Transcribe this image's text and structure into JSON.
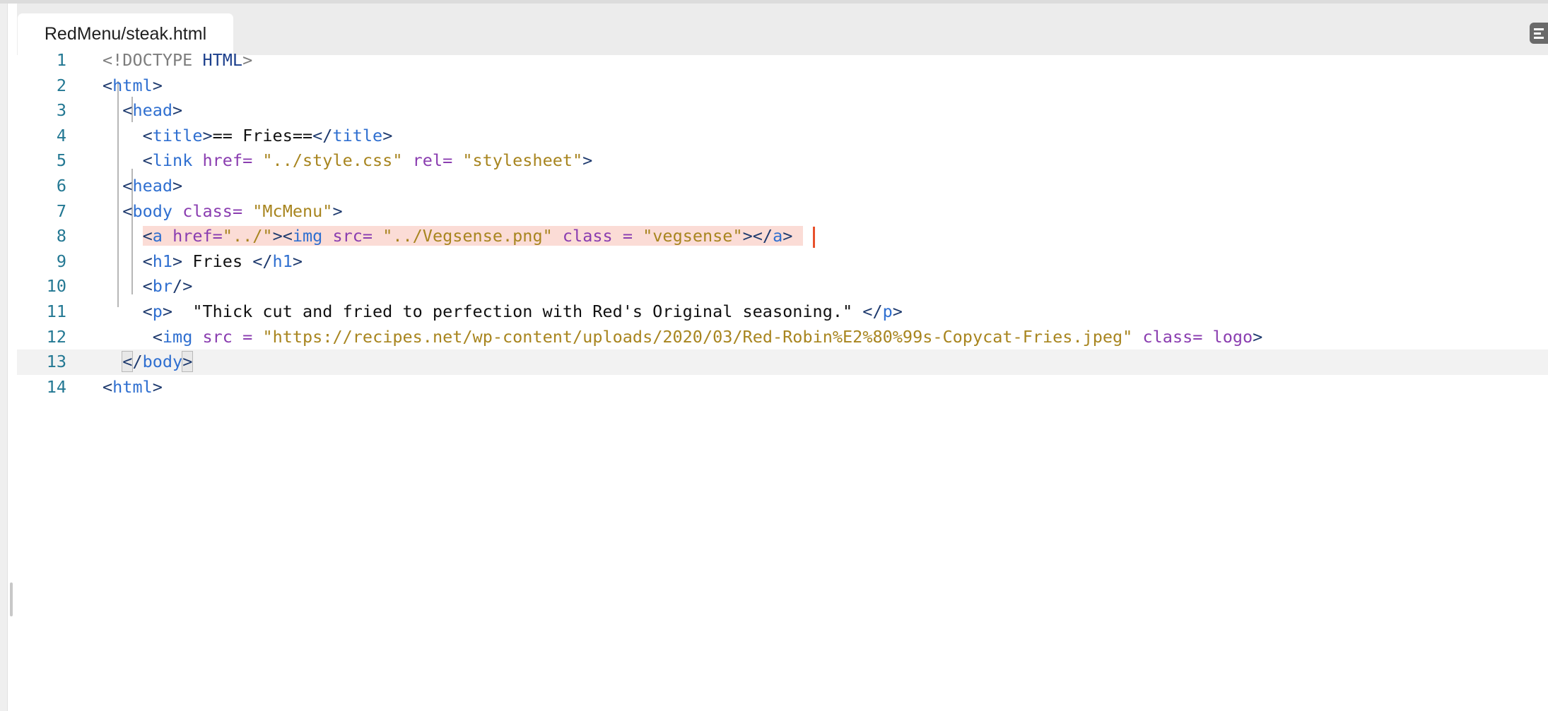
{
  "tab": {
    "label": "RedMenu/steak.html"
  },
  "editor": {
    "current_line": 13,
    "lines": [
      {
        "n": "1",
        "parts": [
          [
            "doc",
            "<!DOCTYPE "
          ],
          [
            "doc2",
            "HTML"
          ],
          [
            "doc",
            ">"
          ]
        ]
      },
      {
        "n": "2",
        "parts": [
          [
            "br",
            "<"
          ],
          [
            "tag",
            "html"
          ],
          [
            "br",
            ">"
          ]
        ]
      },
      {
        "n": "3",
        "parts": [
          [
            "txt",
            "  "
          ],
          [
            "br",
            "<"
          ],
          [
            "tag",
            "head"
          ],
          [
            "br",
            ">"
          ]
        ]
      },
      {
        "n": "4",
        "parts": [
          [
            "txt",
            "    "
          ],
          [
            "br",
            "<"
          ],
          [
            "tag",
            "title"
          ],
          [
            "br",
            ">"
          ],
          [
            "txt",
            "== Fries=="
          ],
          [
            "br",
            "</"
          ],
          [
            "tag",
            "title"
          ],
          [
            "br",
            ">"
          ]
        ]
      },
      {
        "n": "5",
        "parts": [
          [
            "txt",
            "    "
          ],
          [
            "br",
            "<"
          ],
          [
            "tag",
            "link"
          ],
          [
            "txt",
            " "
          ],
          [
            "attr",
            "href="
          ],
          [
            "txt",
            " "
          ],
          [
            "str",
            "\"../style.css\""
          ],
          [
            "txt",
            " "
          ],
          [
            "attr",
            "rel="
          ],
          [
            "txt",
            " "
          ],
          [
            "str",
            "\"stylesheet\""
          ],
          [
            "br",
            ">"
          ]
        ]
      },
      {
        "n": "6",
        "parts": [
          [
            "txt",
            "  "
          ],
          [
            "br",
            "<"
          ],
          [
            "tag",
            "head"
          ],
          [
            "br",
            ">"
          ]
        ]
      },
      {
        "n": "7",
        "parts": [
          [
            "txt",
            "  "
          ],
          [
            "br",
            "<"
          ],
          [
            "tag",
            "body"
          ],
          [
            "txt",
            " "
          ],
          [
            "attr",
            "class="
          ],
          [
            "txt",
            " "
          ],
          [
            "str",
            "\"McMenu\""
          ],
          [
            "br",
            ">"
          ]
        ]
      },
      {
        "n": "8",
        "parts": [
          [
            "txt",
            "    "
          ],
          [
            "err:br",
            "<"
          ],
          [
            "err:tag",
            "a"
          ],
          [
            "err:txt",
            " "
          ],
          [
            "err:attr",
            "href="
          ],
          [
            "err:str",
            "\"../\""
          ],
          [
            "err:br",
            "><"
          ],
          [
            "err:tag",
            "img"
          ],
          [
            "err:txt",
            " "
          ],
          [
            "err:attr",
            "src="
          ],
          [
            "err:txt",
            " "
          ],
          [
            "err:str",
            "\"../Vegsense.png\""
          ],
          [
            "err:txt",
            " "
          ],
          [
            "err:attr",
            "class"
          ],
          [
            "err:txt",
            " "
          ],
          [
            "err:attr",
            "="
          ],
          [
            "err:txt",
            " "
          ],
          [
            "err:str",
            "\"vegsense\""
          ],
          [
            "err:br",
            "></"
          ],
          [
            "err:tag",
            "a"
          ],
          [
            "err:br",
            ">"
          ],
          [
            "err:txt",
            " "
          ]
        ]
      },
      {
        "n": "9",
        "parts": [
          [
            "txt",
            "    "
          ],
          [
            "br",
            "<"
          ],
          [
            "tag",
            "h1"
          ],
          [
            "br",
            ">"
          ],
          [
            "txt",
            " Fries "
          ],
          [
            "br",
            "</"
          ],
          [
            "tag",
            "h1"
          ],
          [
            "br",
            ">"
          ]
        ]
      },
      {
        "n": "10",
        "parts": [
          [
            "txt",
            "    "
          ],
          [
            "br",
            "<"
          ],
          [
            "tag",
            "br"
          ],
          [
            "br",
            "/>"
          ]
        ]
      },
      {
        "n": "11",
        "parts": [
          [
            "txt",
            "    "
          ],
          [
            "br",
            "<"
          ],
          [
            "tag",
            "p"
          ],
          [
            "br",
            ">"
          ],
          [
            "txt",
            "  \"Thick cut and fried to perfection with Red's Original seasoning.\" "
          ],
          [
            "br",
            "</"
          ],
          [
            "tag",
            "p"
          ],
          [
            "br",
            ">"
          ]
        ]
      },
      {
        "n": "12",
        "parts": [
          [
            "txt",
            "     "
          ],
          [
            "br",
            "<"
          ],
          [
            "tag",
            "img"
          ],
          [
            "txt",
            " "
          ],
          [
            "attr",
            "src"
          ],
          [
            "txt",
            " "
          ],
          [
            "attr",
            "="
          ],
          [
            "txt",
            " "
          ],
          [
            "str",
            "\"https://recipes.net/wp-content/uploads/2020/03/Red-Robin%E2%80%99s-Copycat-Fries.jpeg\""
          ],
          [
            "txt",
            " "
          ],
          [
            "attr",
            "class="
          ],
          [
            "txt",
            " "
          ],
          [
            "logo",
            "logo"
          ],
          [
            "br",
            ">"
          ]
        ]
      },
      {
        "n": "13",
        "parts": [
          [
            "txt",
            "  "
          ],
          [
            "match:br",
            "<"
          ],
          [
            "br",
            "/"
          ],
          [
            "tag",
            "body"
          ],
          [
            "match:br",
            ">"
          ]
        ]
      },
      {
        "n": "14",
        "parts": [
          [
            "br",
            "<"
          ],
          [
            "tag",
            "html"
          ],
          [
            "br",
            ">"
          ]
        ]
      }
    ]
  }
}
